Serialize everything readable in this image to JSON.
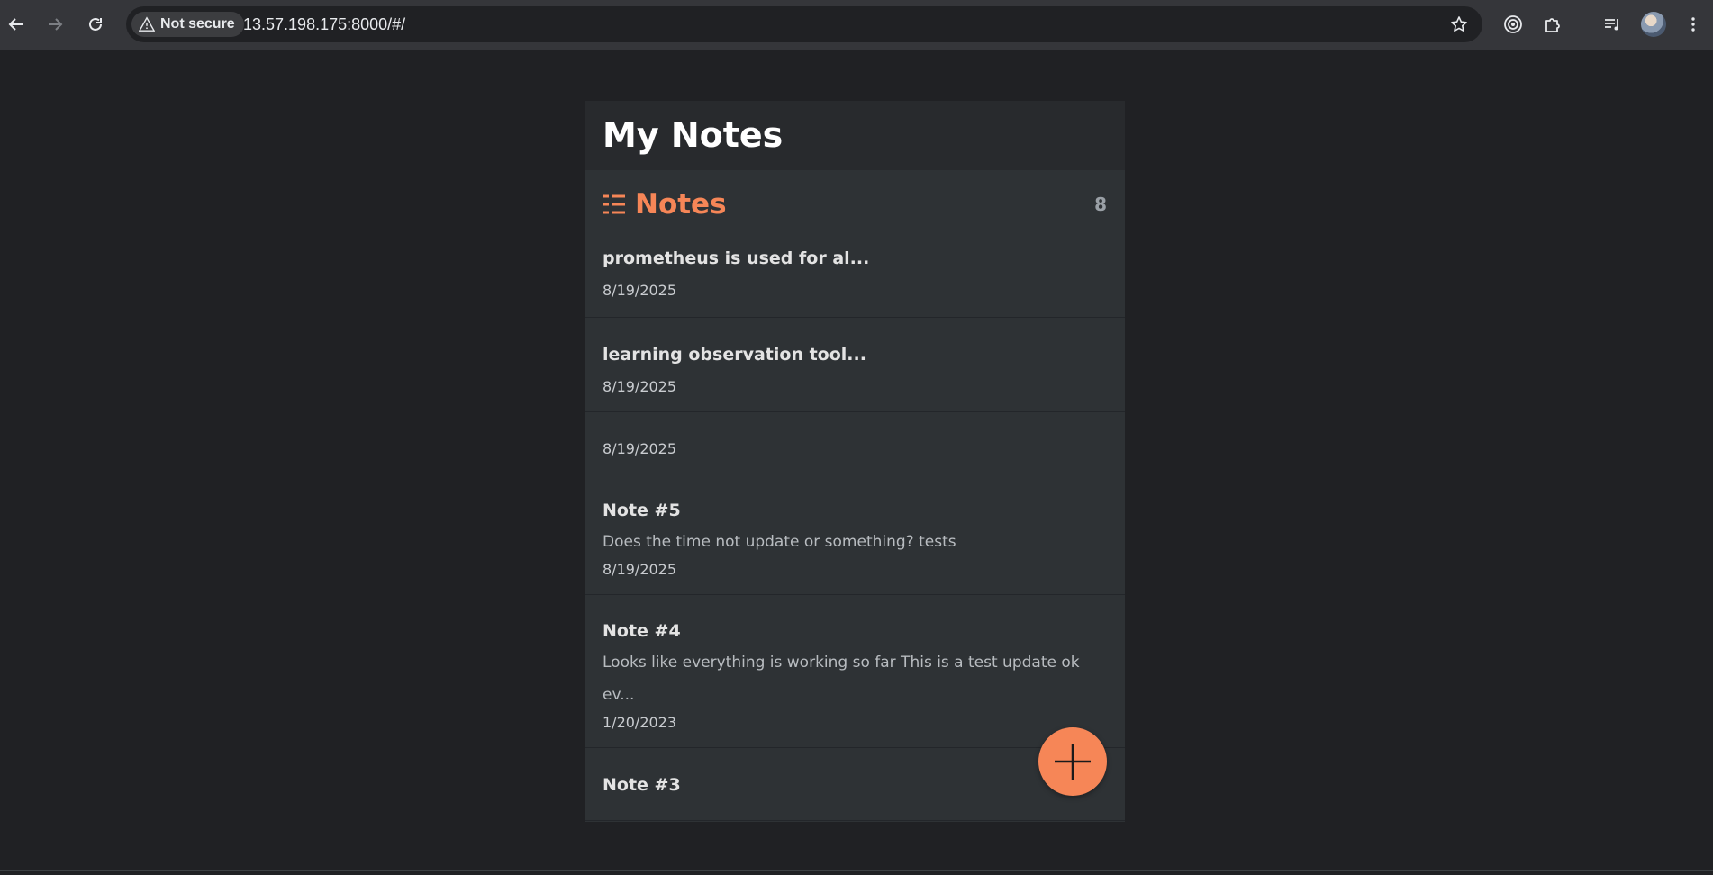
{
  "browser": {
    "security_label": "Not secure",
    "url": "13.57.198.175:8000/#/"
  },
  "app": {
    "title": "My Notes",
    "section_title": "Notes",
    "count": "8",
    "notes": [
      {
        "title": "prometheus is used for al...",
        "body": "",
        "date": "8/19/2025"
      },
      {
        "title": "learning observation tool...",
        "body": "",
        "date": "8/19/2025"
      },
      {
        "title": "",
        "body": "",
        "date": "8/19/2025"
      },
      {
        "title": "Note #5",
        "body": "Does the time not update or something? tests",
        "date": "8/19/2025"
      },
      {
        "title": "Note #4",
        "body": "Looks like everything is working so far This is a test update ok ev...",
        "date": "1/20/2023"
      },
      {
        "title": "Note #3",
        "body": "",
        "date": ""
      }
    ],
    "accent_color": "#f68657"
  }
}
